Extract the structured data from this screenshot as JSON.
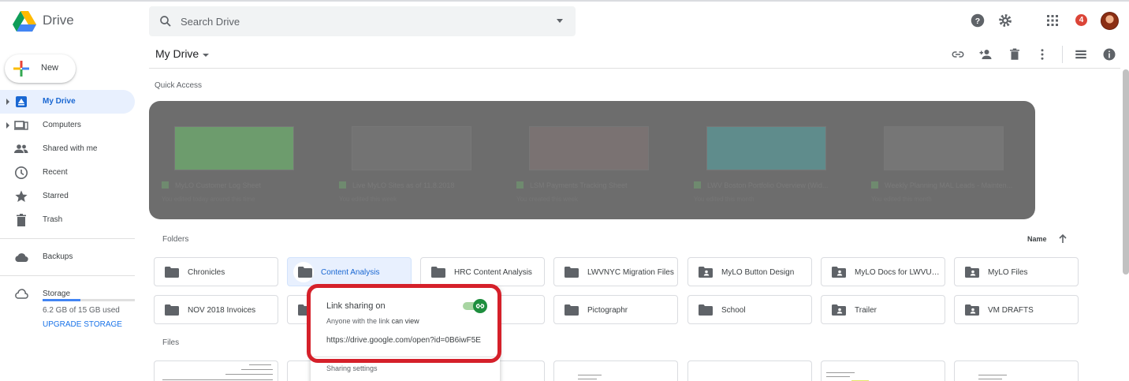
{
  "app": {
    "name": "Drive"
  },
  "search": {
    "placeholder": "Search Drive"
  },
  "topbar": {
    "notification_count": "4"
  },
  "new_button": {
    "label": "New"
  },
  "sidebar": {
    "items": [
      {
        "label": "My Drive",
        "icon": "my-drive-icon",
        "active": true
      },
      {
        "label": "Computers",
        "icon": "computers-icon"
      },
      {
        "label": "Shared with me",
        "icon": "shared-icon"
      },
      {
        "label": "Recent",
        "icon": "clock-icon"
      },
      {
        "label": "Starred",
        "icon": "star-icon"
      },
      {
        "label": "Trash",
        "icon": "trash-icon"
      }
    ],
    "backups": {
      "label": "Backups",
      "icon": "cloud-icon"
    },
    "storage": {
      "label": "Storage",
      "icon": "cloud-outline-icon",
      "used_text": "6.2 GB of 15 GB used",
      "upgrade_label": "UPGRADE STORAGE",
      "used_fraction": 0.41
    }
  },
  "main": {
    "title": "My Drive",
    "quick_access_label": "Quick Access",
    "folders_label": "Folders",
    "files_label": "Files",
    "sort_label": "Name"
  },
  "quick_access": [
    {
      "title": "MyLO Customer Log Sheet",
      "sub": "You edited today around this time"
    },
    {
      "title": "Live MyLO Sites as of 11.8.2018",
      "sub": "You edited this week"
    },
    {
      "title": "LSM Payments Tracking Sheet",
      "sub": "You created this week"
    },
    {
      "title": "LWV Boston Portfolio Overview (Wid...",
      "sub": "You edited this month"
    },
    {
      "title": "Weekly Planning MAL Leads - Mainten...",
      "sub": "You edited this month"
    }
  ],
  "folders": [
    {
      "label": "Chronicles",
      "shared": false
    },
    {
      "label": "Content Analysis",
      "shared": false,
      "selected": true
    },
    {
      "label": "HRC Content Analysis",
      "shared": false
    },
    {
      "label": "LWVNYC Migration Files",
      "shared": false
    },
    {
      "label": "MyLO Button Design",
      "shared": true
    },
    {
      "label": "MyLO Docs for LWVUS...",
      "shared": true
    },
    {
      "label": "MyLO Files",
      "shared": true
    },
    {
      "label": "NOV 2018 Invoices",
      "shared": false
    },
    {
      "label": "",
      "shared": false
    },
    {
      "label": "",
      "shared": false
    },
    {
      "label": "Pictographr",
      "shared": false
    },
    {
      "label": "School",
      "shared": false
    },
    {
      "label": "Trailer",
      "shared": true
    },
    {
      "label": "VM DRAFTS",
      "shared": true
    }
  ],
  "share_popup": {
    "title": "Link sharing on",
    "desc_prefix": "Anyone with the link",
    "desc_access": "can view",
    "link": "https://drive.google.com/open?id=0B6iwF5E",
    "settings_label": "Sharing settings",
    "toggle_on": true,
    "highlight_color": "#d5202a"
  },
  "colors": {
    "accent": "#1a73e8",
    "active_bg": "#e8f0fe",
    "toggle_green": "#1e8e3e"
  }
}
